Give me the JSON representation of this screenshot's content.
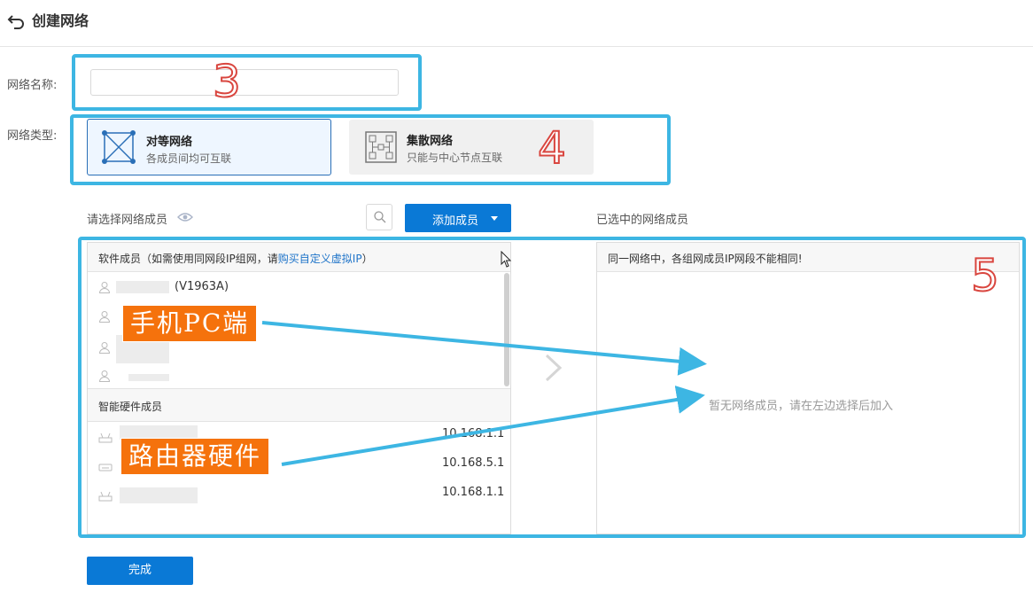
{
  "header": {
    "title": "创建网络"
  },
  "form": {
    "name_label": "网络名称:",
    "name_value": "",
    "type_label": "网络类型:",
    "types": [
      {
        "title": "对等网络",
        "desc": "各成员间均可互联",
        "selected": true
      },
      {
        "title": "集散网络",
        "desc": "只能与中心节点互联",
        "selected": false
      }
    ]
  },
  "annotations": {
    "step3": "3",
    "step4": "4",
    "step5": "5",
    "callout_mobile": "手机PC端",
    "callout_router": "路由器硬件"
  },
  "members": {
    "select_label": "请选择网络成员",
    "add_button": "添加成员",
    "selected_label": "已选中的网络成员",
    "software_header_prefix": "软件成员（如需使用同网段IP组网，请",
    "software_header_link": "购买自定义虚拟IP",
    "software_header_suffix": "）",
    "software_items": [
      {
        "name_suffix": "(V1963A)"
      }
    ],
    "hardware_header": "智能硬件成员",
    "hardware_items": [
      {
        "ip": "10.168.1.1"
      },
      {
        "ip": "10.168.5.1"
      },
      {
        "ip": "10.168.1.1"
      }
    ],
    "right_header": "同一网络中，各组网成员IP网段不能相同!",
    "empty_text": "暂无网络成员，请在左边选择后加入"
  },
  "footer": {
    "done_button": "完成"
  },
  "colors": {
    "primary": "#0a79d6",
    "highlight": "#3db6e3",
    "callout": "#f5720c",
    "number_stroke": "#d9463f"
  }
}
